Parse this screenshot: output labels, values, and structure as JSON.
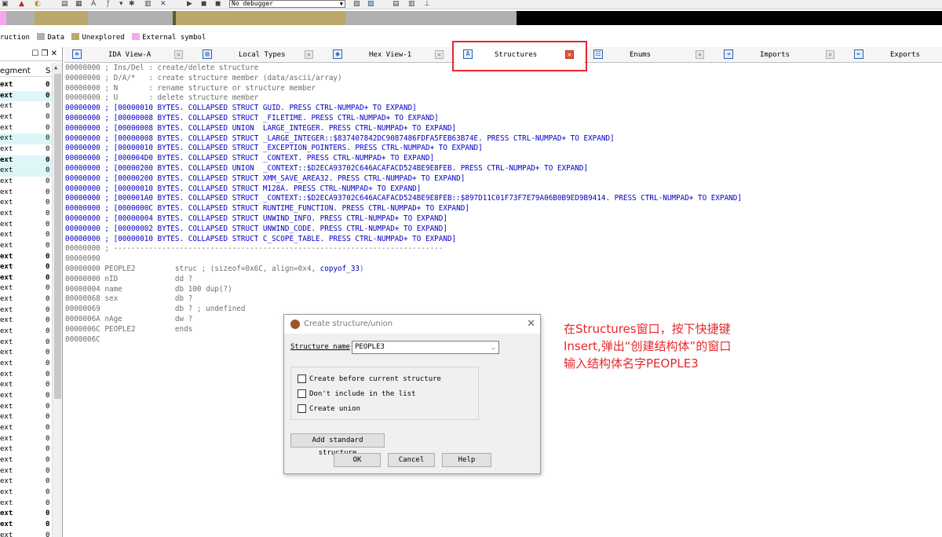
{
  "toolbar": {
    "debugger_select": "No debugger",
    "icons": [
      "new-file-icon",
      "warning-icon",
      "search-icon",
      "graph-icon",
      "hex-icon",
      "struct-icon",
      "function-icon",
      "arrow-icon",
      "star-icon",
      "chart-icon",
      "cut-icon",
      "play-icon",
      "pause-icon",
      "stop-icon",
      "debug-settings-icon",
      "debug-options-icon",
      "list-icon",
      "edit-icon",
      "tree-icon"
    ]
  },
  "legend": {
    "items": [
      {
        "label": "ruction",
        "color": "#ffffff"
      },
      {
        "label": "Data",
        "color": "#b0b0b0"
      },
      {
        "label": "Unexplored",
        "color": "#b9a86a"
      },
      {
        "label": "External symbol",
        "color": "#f7a6ee"
      }
    ]
  },
  "segments_panel": {
    "controls": "☐ ❒ ✕",
    "col_segment": "egment",
    "col_s": "S",
    "rows": [
      {
        "name": "ext",
        "val": "0",
        "bold": true,
        "hl": ""
      },
      {
        "name": "ext",
        "val": "0",
        "bold": true,
        "hl": "#ddf6f8"
      },
      {
        "name": "ext",
        "val": "0",
        "bold": false,
        "hl": ""
      },
      {
        "name": "ext",
        "val": "0",
        "bold": false,
        "hl": ""
      },
      {
        "name": "ext",
        "val": "0",
        "bold": false,
        "hl": ""
      },
      {
        "name": "ext",
        "val": "0",
        "bold": false,
        "hl": "#ddf6f8"
      },
      {
        "name": "ext",
        "val": "0",
        "bold": false,
        "hl": ""
      },
      {
        "name": "ext",
        "val": "0",
        "bold": true,
        "hl": "#ddf6f8"
      },
      {
        "name": "ext",
        "val": "0",
        "bold": false,
        "hl": "#ddf6f8"
      },
      {
        "name": "ext",
        "val": "0",
        "bold": false,
        "hl": ""
      },
      {
        "name": "ext",
        "val": "0",
        "bold": false,
        "hl": ""
      },
      {
        "name": "ext",
        "val": "0",
        "bold": false,
        "hl": ""
      },
      {
        "name": "ext",
        "val": "0",
        "bold": false,
        "hl": ""
      },
      {
        "name": "ext",
        "val": "0",
        "bold": false,
        "hl": ""
      },
      {
        "name": "ext",
        "val": "0",
        "bold": false,
        "hl": ""
      },
      {
        "name": "ext",
        "val": "0",
        "bold": false,
        "hl": ""
      },
      {
        "name": "ext",
        "val": "0",
        "bold": true,
        "hl": ""
      },
      {
        "name": "ext",
        "val": "0",
        "bold": true,
        "hl": ""
      },
      {
        "name": "ext",
        "val": "0",
        "bold": true,
        "hl": ""
      },
      {
        "name": "ext",
        "val": "0",
        "bold": false,
        "hl": ""
      },
      {
        "name": "ext",
        "val": "0",
        "bold": false,
        "hl": ""
      },
      {
        "name": "ext",
        "val": "0",
        "bold": false,
        "hl": ""
      },
      {
        "name": "ext",
        "val": "0",
        "bold": false,
        "hl": ""
      },
      {
        "name": "ext",
        "val": "0",
        "bold": false,
        "hl": ""
      },
      {
        "name": "ext",
        "val": "0",
        "bold": false,
        "hl": ""
      },
      {
        "name": "ext",
        "val": "0",
        "bold": false,
        "hl": ""
      },
      {
        "name": "ext",
        "val": "0",
        "bold": false,
        "hl": ""
      },
      {
        "name": "ext",
        "val": "0",
        "bold": false,
        "hl": ""
      },
      {
        "name": "ext",
        "val": "0",
        "bold": false,
        "hl": ""
      },
      {
        "name": "ext",
        "val": "0",
        "bold": false,
        "hl": ""
      },
      {
        "name": "ext",
        "val": "0",
        "bold": false,
        "hl": ""
      },
      {
        "name": "ext",
        "val": "0",
        "bold": false,
        "hl": ""
      },
      {
        "name": "ext",
        "val": "0",
        "bold": false,
        "hl": ""
      },
      {
        "name": "ext",
        "val": "0",
        "bold": false,
        "hl": ""
      },
      {
        "name": "ext",
        "val": "0",
        "bold": false,
        "hl": ""
      },
      {
        "name": "ext",
        "val": "0",
        "bold": false,
        "hl": ""
      },
      {
        "name": "ext",
        "val": "0",
        "bold": false,
        "hl": ""
      },
      {
        "name": "ext",
        "val": "0",
        "bold": false,
        "hl": ""
      },
      {
        "name": "ext",
        "val": "0",
        "bold": false,
        "hl": ""
      },
      {
        "name": "ext",
        "val": "0",
        "bold": false,
        "hl": ""
      },
      {
        "name": "ext",
        "val": "0",
        "bold": true,
        "hl": ""
      },
      {
        "name": "ext",
        "val": "0",
        "bold": true,
        "hl": ""
      },
      {
        "name": "ext",
        "val": "0",
        "bold": false,
        "hl": ""
      },
      {
        "name": "ext",
        "val": "0",
        "bold": false,
        "hl": ""
      },
      {
        "name": "ext",
        "val": "0",
        "bold": false,
        "hl": "#fbd6f6"
      }
    ]
  },
  "tabs": [
    {
      "label": "IDA View-A",
      "icon": "ida-view-icon",
      "glyph": "≡",
      "active": false
    },
    {
      "label": "Local Types",
      "icon": "local-types-icon",
      "glyph": "▤",
      "active": false
    },
    {
      "label": "Hex View-1",
      "icon": "hex-view-icon",
      "glyph": "◉",
      "active": false
    },
    {
      "label": "Structures",
      "icon": "structures-icon",
      "glyph": "A",
      "active": true
    },
    {
      "label": "Enums",
      "icon": "enums-icon",
      "glyph": "☷",
      "active": false
    },
    {
      "label": "Imports",
      "icon": "imports-icon",
      "glyph": "⇥",
      "active": false
    },
    {
      "label": "Exports",
      "icon": "exports-icon",
      "glyph": "⇤",
      "active": false
    }
  ],
  "code_lines": [
    {
      "addr": "00000000",
      "text": " ; Ins/Del : create/delete structure",
      "cls": ""
    },
    {
      "addr": "00000000",
      "text": " ; D/A/*   : create structure member (data/ascii/array)",
      "cls": ""
    },
    {
      "addr": "00000000",
      "text": " ; N       : rename structure or structure member",
      "cls": ""
    },
    {
      "addr": "00000000",
      "text": " ; U       : delete structure member",
      "cls": ""
    },
    {
      "addr": "00000000",
      "text": " ; [00000010 BYTES. COLLAPSED STRUCT GUID. PRESS CTRL-NUMPAD+ TO EXPAND]",
      "cls": "blue"
    },
    {
      "addr": "00000000",
      "text": " ; [00000008 BYTES. COLLAPSED STRUCT _FILETIME. PRESS CTRL-NUMPAD+ TO EXPAND]",
      "cls": "blue"
    },
    {
      "addr": "00000000",
      "text": " ; [00000008 BYTES. COLLAPSED UNION  LARGE_INTEGER. PRESS CTRL-NUMPAD+ TO EXPAND]",
      "cls": "blue"
    },
    {
      "addr": "00000000",
      "text": " ; [00000008 BYTES. COLLAPSED STRUCT _LARGE_INTEGER::$837407842DC9087486FDFA5FEB63B74E. PRESS CTRL-NUMPAD+ TO EXPAND]",
      "cls": "blue"
    },
    {
      "addr": "00000000",
      "text": " ; [00000010 BYTES. COLLAPSED STRUCT _EXCEPTION_POINTERS. PRESS CTRL-NUMPAD+ TO EXPAND]",
      "cls": "blue"
    },
    {
      "addr": "00000000",
      "text": " ; [000004D0 BYTES. COLLAPSED STRUCT _CONTEXT. PRESS CTRL-NUMPAD+ TO EXPAND]",
      "cls": "blue"
    },
    {
      "addr": "00000000",
      "text": " ; [00000200 BYTES. COLLAPSED UNION  _CONTEXT::$D2ECA93702C646ACAFACD524BE9E8FEB. PRESS CTRL-NUMPAD+ TO EXPAND]",
      "cls": "blue"
    },
    {
      "addr": "00000000",
      "text": " ; [00000200 BYTES. COLLAPSED STRUCT XMM_SAVE_AREA32. PRESS CTRL-NUMPAD+ TO EXPAND]",
      "cls": "blue"
    },
    {
      "addr": "00000000",
      "text": " ; [00000010 BYTES. COLLAPSED STRUCT M128A. PRESS CTRL-NUMPAD+ TO EXPAND]",
      "cls": "blue"
    },
    {
      "addr": "00000000",
      "text": " ; [000001A0 BYTES. COLLAPSED STRUCT _CONTEXT::$D2ECA93702C646ACAFACD524BE9E8FEB::$897D11C01F73F7E79A06B0B9ED9B9414. PRESS CTRL-NUMPAD+ TO EXPAND]",
      "cls": "blue"
    },
    {
      "addr": "00000000",
      "text": " ; [0000000C BYTES. COLLAPSED STRUCT RUNTIME_FUNCTION. PRESS CTRL-NUMPAD+ TO EXPAND]",
      "cls": "blue"
    },
    {
      "addr": "00000000",
      "text": " ; [00000004 BYTES. COLLAPSED STRUCT UNWIND_INFO. PRESS CTRL-NUMPAD+ TO EXPAND]",
      "cls": "blue"
    },
    {
      "addr": "00000000",
      "text": " ; [00000002 BYTES. COLLAPSED STRUCT UNWIND_CODE. PRESS CTRL-NUMPAD+ TO EXPAND]",
      "cls": "blue"
    },
    {
      "addr": "00000000",
      "text": " ; [00000010 BYTES. COLLAPSED STRUCT C_SCOPE_TABLE. PRESS CTRL-NUMPAD+ TO EXPAND]",
      "cls": "blue"
    },
    {
      "addr": "00000000",
      "text": " ; ---------------------------------------------------------------------------",
      "cls": ""
    },
    {
      "addr": "00000000",
      "text": "",
      "cls": ""
    },
    {
      "addr": "00000000",
      "text": " PEOPLE2         struc ; (sizeof=0x6C, align=0x4, ",
      "cls": "",
      "link": "copyof_33",
      "after": ")"
    },
    {
      "addr": "00000000",
      "text": " nID             dd ?",
      "cls": ""
    },
    {
      "addr": "00000004",
      "text": " name            db 100 dup(?)",
      "cls": ""
    },
    {
      "addr": "00000068",
      "text": " sex             db ?",
      "cls": ""
    },
    {
      "addr": "00000069",
      "text": "                 db ? ; undefined",
      "cls": ""
    },
    {
      "addr": "0000006A",
      "text": " nAge            dw ?",
      "cls": ""
    },
    {
      "addr": "0000006C",
      "text": " PEOPLE2         ends",
      "cls": ""
    },
    {
      "addr": "0000006C",
      "text": "",
      "cls": ""
    }
  ],
  "annotation": {
    "lines": [
      "在Structures窗口，按下快捷键",
      "Insert,弹出“创建结构体”的窗口",
      "输入结构体名字PEOPLE3"
    ],
    "color": "#e8262b"
  },
  "dialog": {
    "title": "Create structure/union",
    "name_label": "Structure name",
    "name_value": "PEOPLE3",
    "checkboxes": [
      {
        "label": "Create before current structure",
        "checked": false
      },
      {
        "label": "Don't include in the list",
        "checked": false
      },
      {
        "label": "Create union",
        "checked": false
      }
    ],
    "add_standard": "Add standard structure",
    "ok": "OK",
    "cancel": "Cancel",
    "help": "Help"
  }
}
